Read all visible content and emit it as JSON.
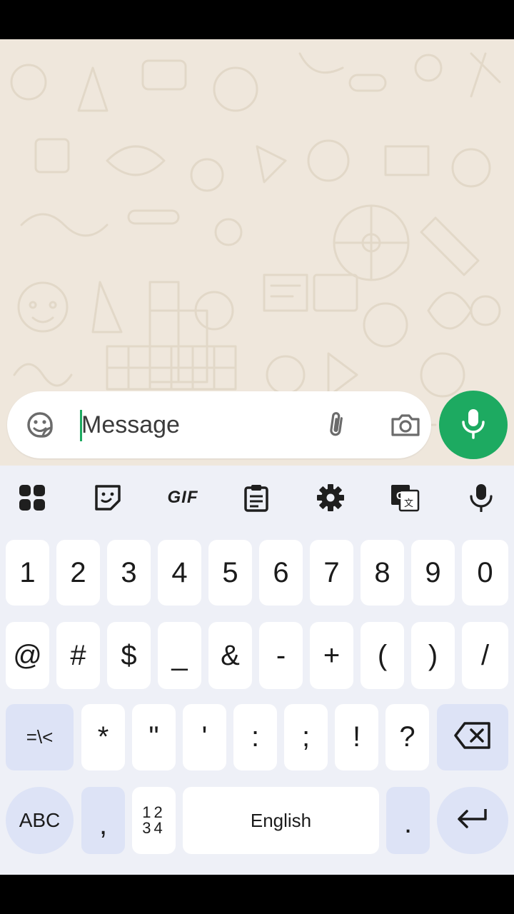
{
  "composer": {
    "placeholder": "Message"
  },
  "toolbar": {
    "gif_label": "GIF"
  },
  "keyboard": {
    "row1": [
      "1",
      "2",
      "3",
      "4",
      "5",
      "6",
      "7",
      "8",
      "9",
      "0"
    ],
    "row2": [
      "@",
      "#",
      "$",
      "_",
      "&",
      "-",
      "+",
      "(",
      ")",
      "/"
    ],
    "row3_mod": "=\\<",
    "row3": [
      "*",
      "\"",
      "'",
      ":",
      ";",
      "!",
      "?"
    ],
    "abc_label": "ABC",
    "comma": ",",
    "num_toggle_top": "12",
    "num_toggle_bottom": "34",
    "space_label": "English",
    "period": "."
  },
  "colors": {
    "accent_green": "#1daa61",
    "chat_background": "#efe7dc",
    "keyboard_background": "#eef0f7",
    "function_key": "#dde3f6"
  },
  "icons": {
    "composer": [
      "sticker-icon",
      "paperclip-icon",
      "camera-icon"
    ],
    "fab": "microphone-icon",
    "toolbar": [
      "apps-grid-icon",
      "sticker-icon",
      "gif-icon",
      "clipboard-icon",
      "settings-icon",
      "translate-icon",
      "microphone-icon"
    ],
    "keys": [
      "backspace-icon",
      "enter-icon"
    ]
  }
}
